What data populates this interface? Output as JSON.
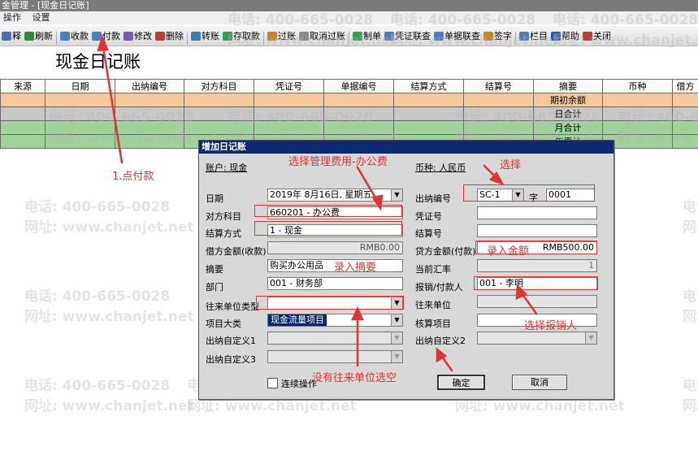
{
  "window": {
    "title": "金管理 - [现金日记账]"
  },
  "menu": [
    "操作",
    "设置"
  ],
  "toolbar": [
    {
      "label": "释",
      "color": "#4a6fb0"
    },
    {
      "label": "刷新",
      "color": "#2c8a3a"
    },
    {
      "label": "收款",
      "color": "#4f7cc0"
    },
    {
      "label": "付款",
      "color": "#4f7cc0"
    },
    {
      "label": "修改",
      "color": "#7a5ab0"
    },
    {
      "label": "删除",
      "color": "#c03a3a"
    },
    {
      "label": "转账",
      "color": "#3a7ab0"
    },
    {
      "label": "存取款",
      "color": "#3a9a5a"
    },
    {
      "label": "过账",
      "color": "#c08a20"
    },
    {
      "label": "取消过账",
      "color": "#8a8a8a"
    },
    {
      "label": "制单",
      "color": "#3a9a5a"
    },
    {
      "label": "凭证联查",
      "color": "#4f7cc0"
    },
    {
      "label": "单据联查",
      "color": "#4f7cc0"
    },
    {
      "label": "签字",
      "color": "#c08a20"
    },
    {
      "label": "栏目",
      "color": "#4f7cc0"
    },
    {
      "label": "帮助",
      "color": "#2a5ab0"
    },
    {
      "label": "关闭",
      "color": "#c03a3a"
    }
  ],
  "page_title": "现金日记账",
  "table": {
    "headers": [
      "来源",
      "日期",
      "出纳编号",
      "对方科目",
      "凭证号",
      "单据编号",
      "结算方式",
      "结算号",
      "摘要",
      "币种",
      "借方"
    ],
    "rows": [
      {
        "style": "orange",
        "summary": "期初余额"
      },
      {
        "style": "gray",
        "summary": "日合计"
      },
      {
        "style": "green",
        "summary": "月合计"
      },
      {
        "style": "green",
        "summary": "年累计"
      }
    ]
  },
  "watermark": {
    "phone": "电话: 400-665-0028",
    "site": "网址: www.chanjet.net"
  },
  "dialog": {
    "title": "增加日记账",
    "account_label": "账户: 现金",
    "currency_label": "币种: 人民币",
    "date_label": "日期",
    "date_value": "2019年 8月16日, 星期五",
    "cashier_no_label": "出纳编号",
    "cashier_no_value": "SC-1",
    "word_label": "字",
    "word_value": "0001",
    "contra_label": "对方科目",
    "contra_value": "660201 - 办公费",
    "voucher_label": "凭证号",
    "voucher_value": "",
    "settle_method_label": "结算方式",
    "settle_method_value": "1 - 现金",
    "settle_no_label": "结算号",
    "settle_no_value": "",
    "debit_label": "借方金额(收款)",
    "debit_value": "RMB0.00",
    "credit_label": "贷方金额(付款)",
    "credit_value": "RMB500.00",
    "summary_label": "摘要",
    "summary_value": "购买办公用品",
    "rate_label": "当前汇率",
    "rate_value": "1",
    "dept_label": "部门",
    "dept_value": "001 - 财务部",
    "payee_label": "报销/付款人",
    "payee_value": "001 - 李明",
    "partner_type_label": "往来单位类型",
    "partner_type_value": "",
    "partner_label": "往来单位",
    "partner_value": "",
    "project_class_label": "项目大类",
    "project_class_value": "现金流量项目",
    "project_label": "核算项目",
    "project_value": "",
    "custom1_label": "出纳自定义1",
    "custom2_label": "出纳自定义2",
    "custom3_label": "出纳自定义3",
    "continuous_label": "连续操作",
    "ok_label": "确定",
    "cancel_label": "取消"
  },
  "annotations": {
    "click_pay": "1.点付款",
    "choose_expense": "选择管理费用-办公费",
    "choose": "选择",
    "enter_summary": "录入摘要",
    "enter_amount": "录入金额",
    "choose_payee": "选择报销人",
    "no_partner": "没有往来单位选空"
  },
  "colors": {
    "annotation": "#e23434",
    "dialog_title": "#0c2a6e",
    "selection": "#0a246a"
  }
}
